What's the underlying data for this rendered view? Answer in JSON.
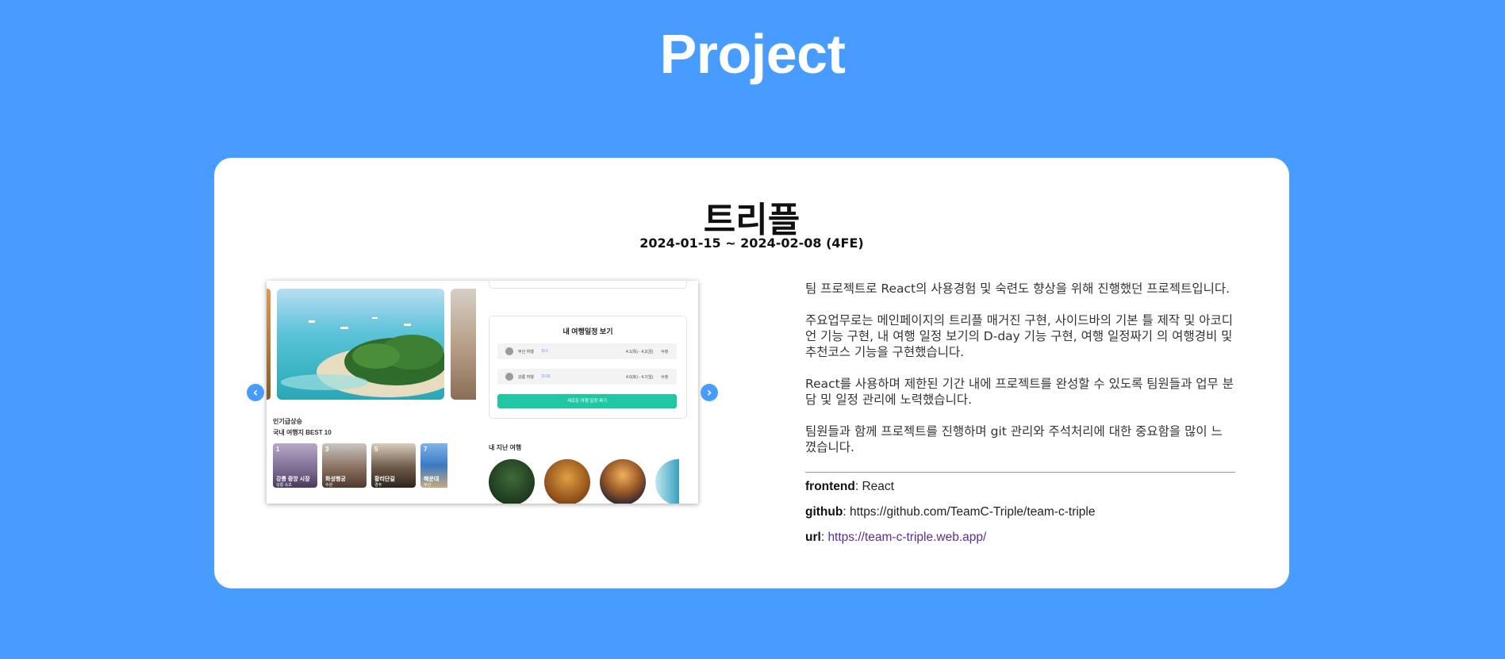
{
  "page": {
    "title": "Project",
    "background_color": "#489cff"
  },
  "project": {
    "name": "트리플",
    "period": "2024-01-15 ~ 2024-02-08 (4FE)",
    "description": [
      "팀 프로젝트로 React의 사용경험 및 숙련도 향상을 위해 진행했던 프로젝트입니다.",
      "주요업무로는 메인페이지의 트리플 매거진 구현, 사이드바의 기본 틀 제작 및 아코디언 기능 구현, 내 여행 일정 보기의 D-day 기능 구현, 여행 일정짜기 의 여행경비 및 추천코스 기능을 구현했습니다.",
      "React를 사용하며 제한된 기간 내에 프로젝트를 완성할 수 있도록 팀원들과 업무 분담 및 일정 관리에 노력했습니다.",
      "팀원들과 함께 프로젝트를 진행하며 git 관리와 주석처리에 대한 중요함을 많이 느꼈습니다."
    ],
    "frontend_label": "frontend",
    "frontend_value": ": React",
    "github_label": "github",
    "github_value": ": https://github.com/TeamC-Triple/team-c-triple",
    "url_label": "url",
    "url_sep": ": ",
    "url_value": "https://team-c-triple.web.app/"
  },
  "carousel": {
    "prev_icon": "chevron-left-icon",
    "next_icon": "chevron-right-icon",
    "screenshot": {
      "my_schedule_title": "내 여행일정 보기",
      "row1_label": "부산 여행",
      "row1_dday": "D-1",
      "row1_dates": "4.1(목) - 4.2(금)",
      "row1_action": "수정",
      "row2_label": "강릉 여행",
      "row2_dday": "D-31",
      "row2_dates": "4.6(토) - 4.7(일)",
      "row2_action": "수정",
      "new_trip_button": "새로운 여행 일정 짜기",
      "popular_sub": "인기급상승",
      "popular_title": "국내 여행지 BEST 10",
      "past_trips": "내 지난 여행",
      "thumbs": [
        {
          "num": "1",
          "name": "강릉 중앙 시장",
          "city": "강릉 속초"
        },
        {
          "num": "3",
          "name": "화성행궁",
          "city": "수원"
        },
        {
          "num": "5",
          "name": "황리단길",
          "city": "경주"
        },
        {
          "num": "7",
          "name": "해운대",
          "city": "부산"
        }
      ],
      "accent_color": "#1fc7a5"
    }
  }
}
